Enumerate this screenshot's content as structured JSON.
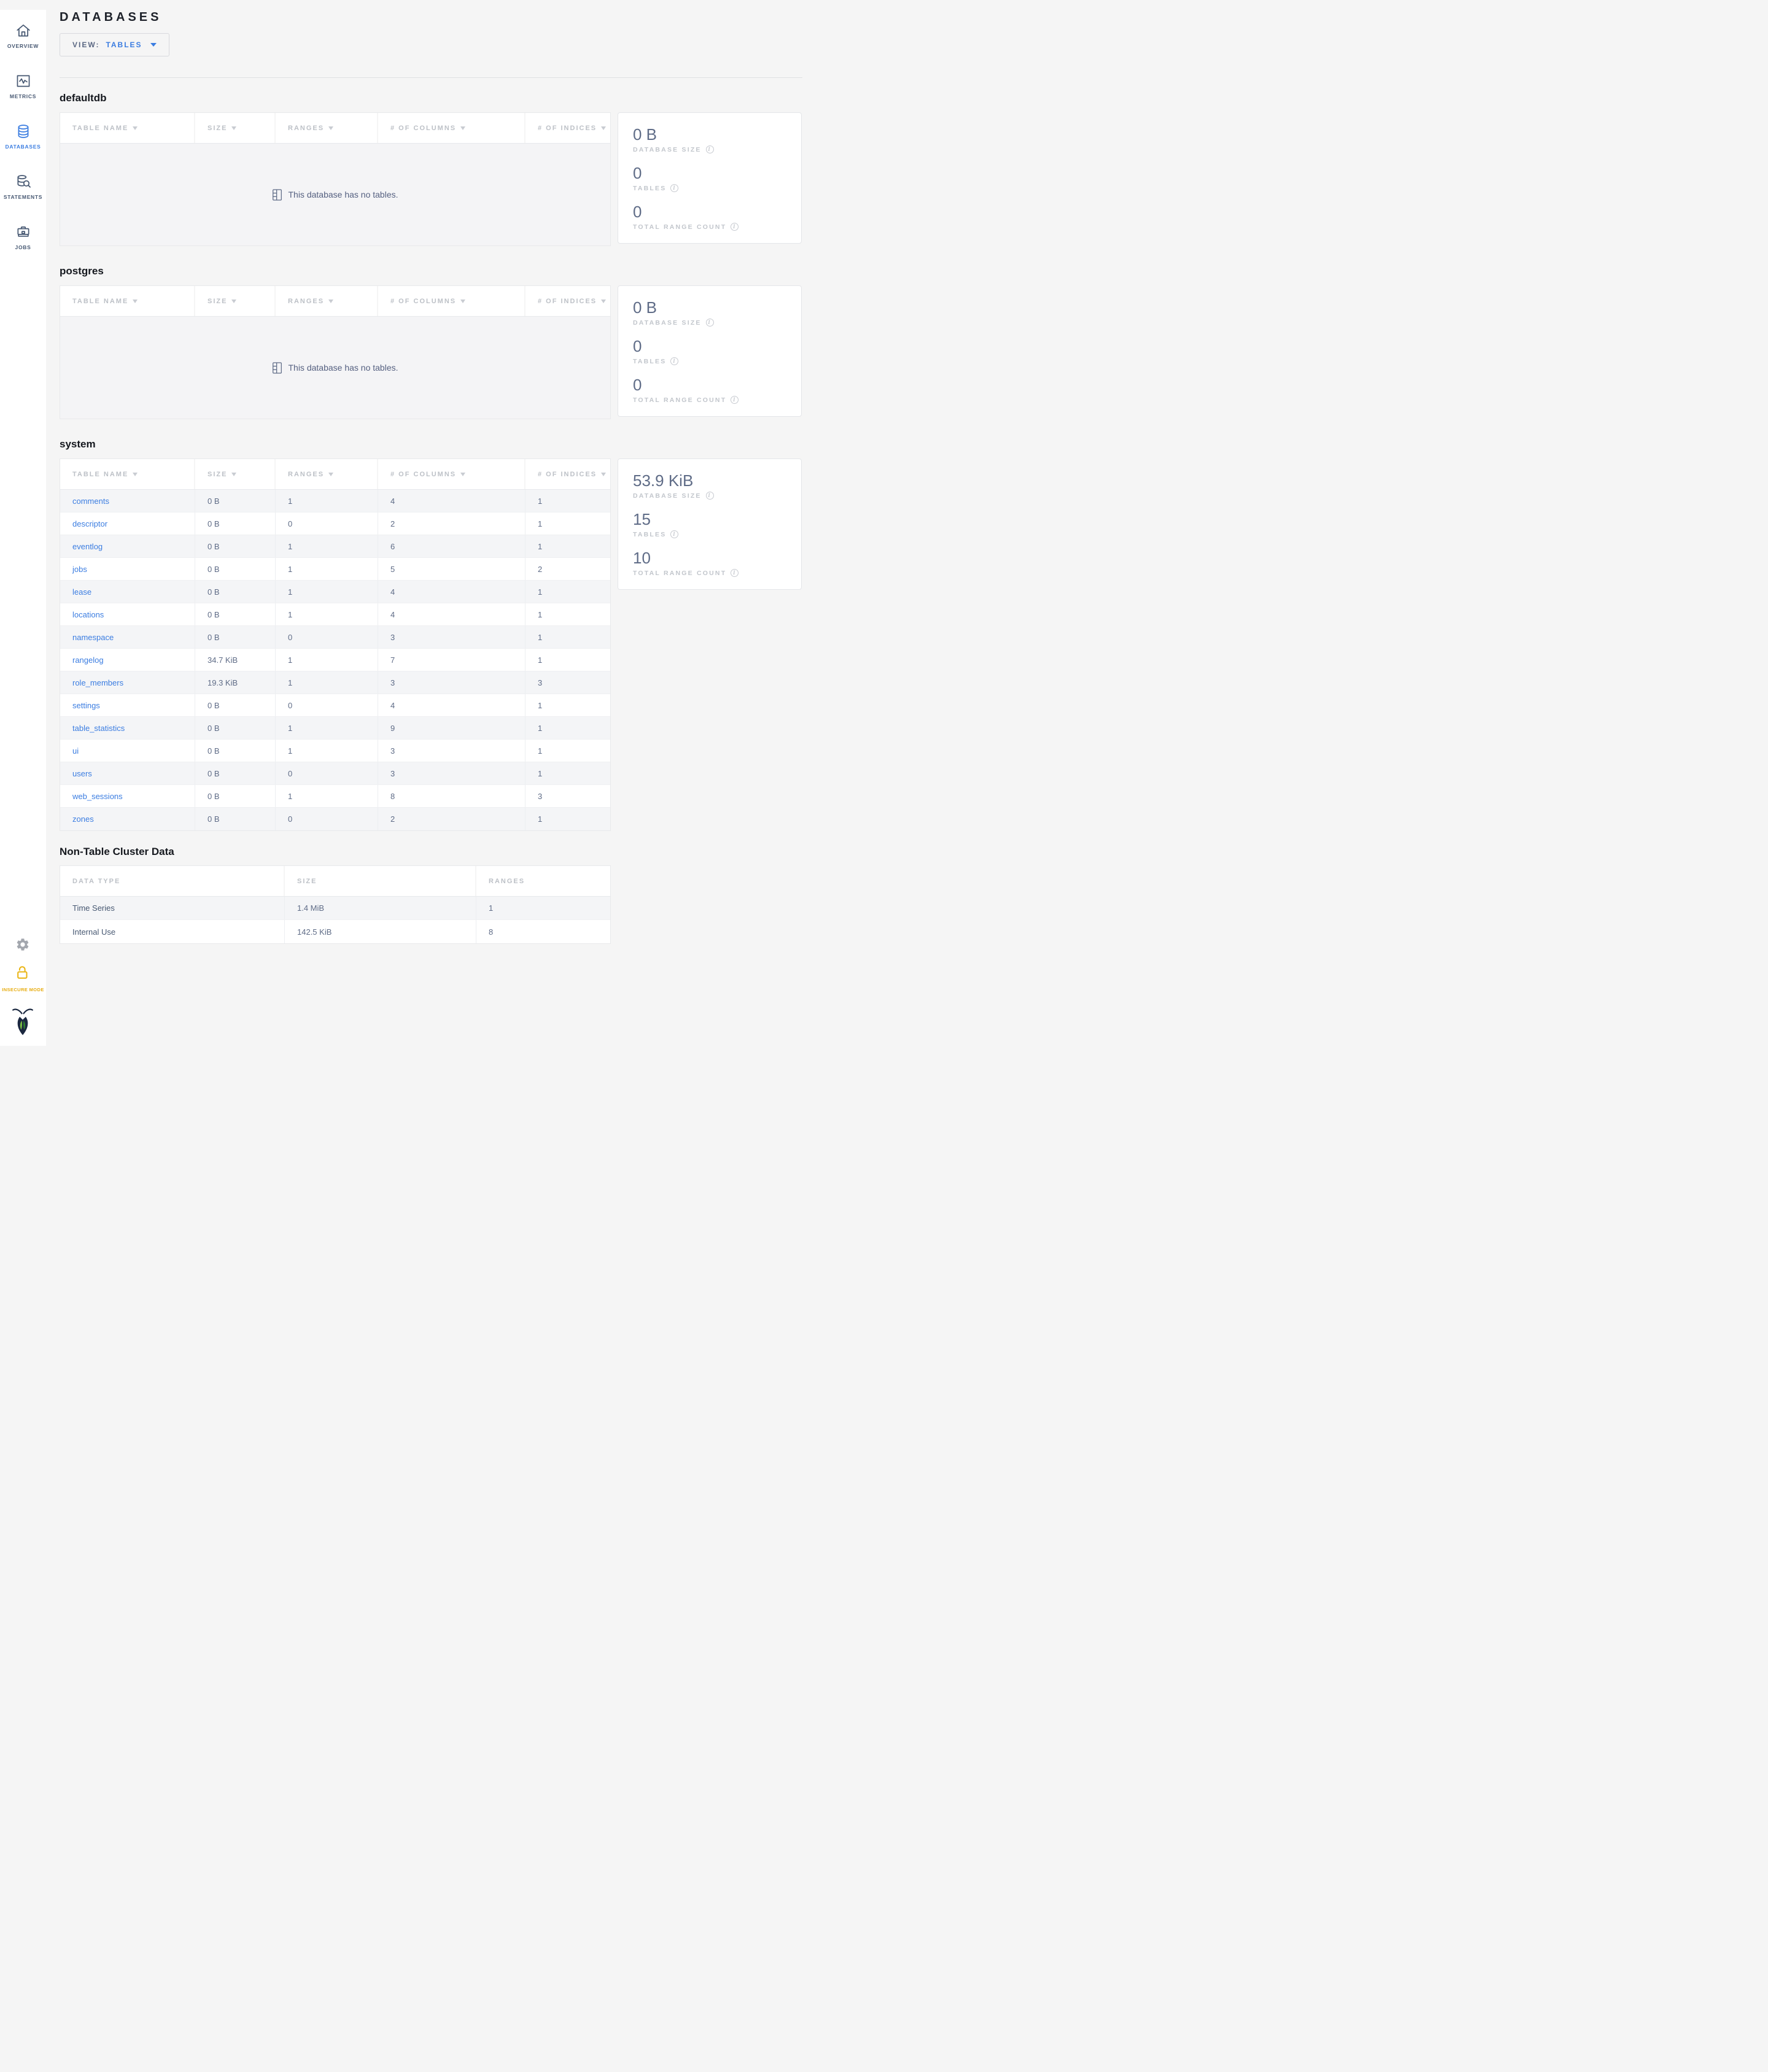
{
  "colors": {
    "accent_blue": "#3b7de1",
    "slate": "#5f6c87",
    "warning_yellow": "#eab516",
    "logo_navy": "#1b2840",
    "logo_green_light": "#7cbf43",
    "logo_green_dark": "#2e7d31",
    "page_bg": "#f5f5f5"
  },
  "page": {
    "title": "DATABASES"
  },
  "view_dropdown": {
    "prefix": "VIEW:",
    "value": "TABLES"
  },
  "sidebar": {
    "items": [
      {
        "label": "OVERVIEW",
        "icon": "home-icon",
        "active": false
      },
      {
        "label": "METRICS",
        "icon": "metrics-icon",
        "active": false
      },
      {
        "label": "DATABASES",
        "icon": "databases-icon",
        "active": true
      },
      {
        "label": "STATEMENTS",
        "icon": "statements-icon",
        "active": false
      },
      {
        "label": "JOBS",
        "icon": "jobs-icon",
        "active": false
      }
    ],
    "insecure_mode_label": "INSECURE MODE"
  },
  "table_headers": {
    "db": [
      "TABLE NAME",
      "SIZE",
      "RANGES",
      "# OF COLUMNS",
      "# OF INDICES"
    ],
    "non_table": [
      "DATA TYPE",
      "SIZE",
      "RANGES"
    ]
  },
  "empty_state": {
    "message": "This database has no tables.",
    "icon": "empty-table-icon"
  },
  "summary_labels": {
    "size": "DATABASE SIZE",
    "tables": "TABLES",
    "ranges": "TOTAL RANGE COUNT"
  },
  "databases": [
    {
      "name": "defaultdb",
      "empty": true,
      "summary": {
        "size": "0 B",
        "tables": "0",
        "ranges": "0"
      }
    },
    {
      "name": "postgres",
      "empty": true,
      "summary": {
        "size": "0 B",
        "tables": "0",
        "ranges": "0"
      }
    },
    {
      "name": "system",
      "empty": false,
      "summary": {
        "size": "53.9 KiB",
        "tables": "15",
        "ranges": "10"
      },
      "rows": [
        [
          "comments",
          "0 B",
          "1",
          "4",
          "1"
        ],
        [
          "descriptor",
          "0 B",
          "0",
          "2",
          "1"
        ],
        [
          "eventlog",
          "0 B",
          "1",
          "6",
          "1"
        ],
        [
          "jobs",
          "0 B",
          "1",
          "5",
          "2"
        ],
        [
          "lease",
          "0 B",
          "1",
          "4",
          "1"
        ],
        [
          "locations",
          "0 B",
          "1",
          "4",
          "1"
        ],
        [
          "namespace",
          "0 B",
          "0",
          "3",
          "1"
        ],
        [
          "rangelog",
          "34.7 KiB",
          "1",
          "7",
          "1"
        ],
        [
          "role_members",
          "19.3 KiB",
          "1",
          "3",
          "3"
        ],
        [
          "settings",
          "0 B",
          "0",
          "4",
          "1"
        ],
        [
          "table_statistics",
          "0 B",
          "1",
          "9",
          "1"
        ],
        [
          "ui",
          "0 B",
          "1",
          "3",
          "1"
        ],
        [
          "users",
          "0 B",
          "0",
          "3",
          "1"
        ],
        [
          "web_sessions",
          "0 B",
          "1",
          "8",
          "3"
        ],
        [
          "zones",
          "0 B",
          "0",
          "2",
          "1"
        ]
      ]
    }
  ],
  "non_table": {
    "title": "Non-Table Cluster Data",
    "rows": [
      [
        "Time Series",
        "1.4 MiB",
        "1"
      ],
      [
        "Internal Use",
        "142.5 KiB",
        "8"
      ]
    ]
  },
  "icons": {
    "info_icon": "i",
    "sort_arrow": "triangle-down"
  }
}
